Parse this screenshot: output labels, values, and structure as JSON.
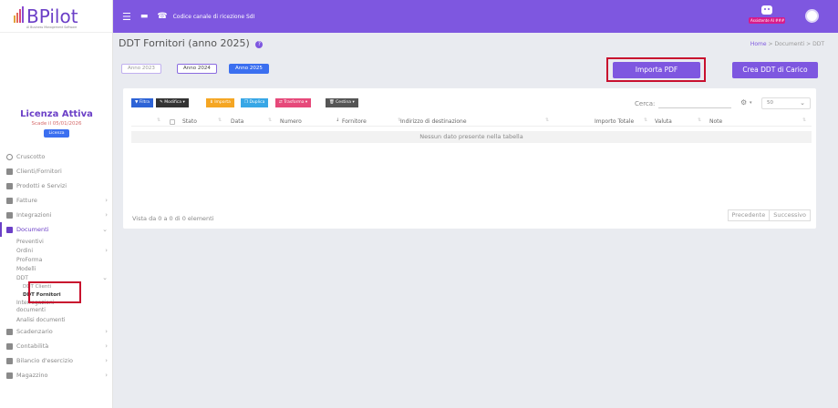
{
  "brand": {
    "name": "BPilot",
    "tagline": "AI Business Management Software"
  },
  "topbar": {
    "notice": "Codice canale di ricezione SdI",
    "ai_assistant": "Assistente AI ###"
  },
  "sidebar": {
    "license_title": "Licenza Attiva",
    "license_expiry": "Scade il 05/01/2026",
    "license_button": "Licenza",
    "menu": [
      {
        "label": "Cruscotto",
        "icon": "dashboard-icon"
      },
      {
        "label": "Clienti/Fornitori",
        "icon": "user-icon"
      },
      {
        "label": "Prodotti e Servizi",
        "icon": "box-icon"
      },
      {
        "label": "Fatture",
        "icon": "invoice-icon"
      },
      {
        "label": "Integrazioni",
        "icon": "integration-icon"
      },
      {
        "label": "Documenti",
        "icon": "document-icon"
      }
    ],
    "doc_subs": [
      "Preventivi",
      "Ordini",
      "ProForma",
      "Modelli",
      "DDT"
    ],
    "ddt_subs": [
      "DDT Clienti",
      "DDT Fornitori"
    ],
    "doc_subs_after": [
      "Interrogazioni documenti",
      "Analisi documenti"
    ],
    "menu_after": [
      {
        "label": "Scadenzario",
        "icon": "calendar-icon"
      },
      {
        "label": "Contabilità",
        "icon": "accounting-icon"
      },
      {
        "label": "Bilancio d'esercizio",
        "icon": "balance-icon"
      },
      {
        "label": "Magazzino",
        "icon": "warehouse-icon"
      }
    ]
  },
  "page": {
    "title": "DDT Fornitori (anno 2025)",
    "breadcrumb": {
      "home": "Home",
      "sep1": ">",
      "section": "Documenti",
      "sep2": ">",
      "current": "DDT"
    }
  },
  "years": [
    "Anno 2023",
    "Anno 2024",
    "Anno 2025"
  ],
  "actions": {
    "import_pdf": "Importa PDF",
    "create_ddt": "Crea DDT di Carico"
  },
  "toolbar": {
    "filtra": "Filtra",
    "modifica": "Modifica",
    "importa": "Importa",
    "duplica": "Duplica",
    "trasforma": "Trasforma",
    "cestina": "Cestina"
  },
  "search": {
    "label": "Cerca:",
    "placeholder": "",
    "page_size": "50"
  },
  "table": {
    "columns": [
      "Stato",
      "Data",
      "Numero",
      "Fornitore",
      "Indirizzo di destinazione",
      "Importo Totale",
      "Valuta",
      "Note"
    ],
    "empty_message": "Nessun dato presente nella tabella"
  },
  "footer": {
    "info": "Vista da 0 a 0 di 0 elementi",
    "prev": "Precedente",
    "next": "Successivo"
  },
  "colors": {
    "primary": "#7e57e0",
    "blue": "#3b6ff0",
    "highlight_box": "#c8102e"
  }
}
